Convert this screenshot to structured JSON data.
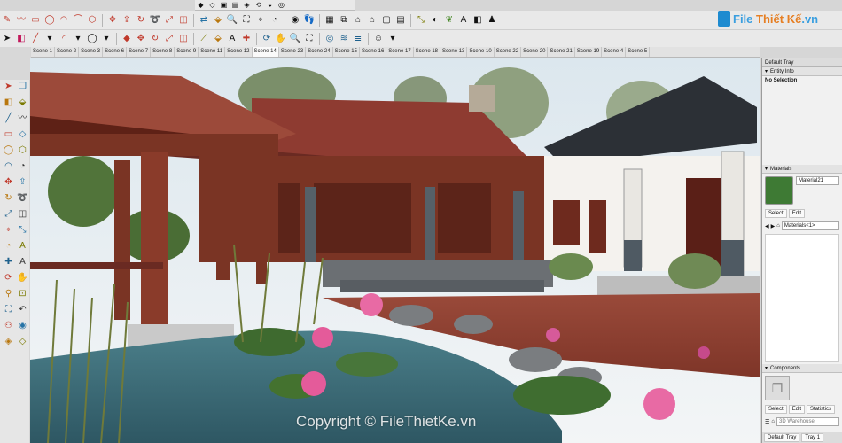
{
  "scenes": [
    "Scene 1",
    "Scene 2",
    "Scene 3",
    "Scene 6",
    "Scene 7",
    "Scene 8",
    "Scene 9",
    "Scene 11",
    "Scene 12",
    "Scene 14",
    "Scene 23",
    "Scene 24",
    "Scene 15",
    "Scene 16",
    "Scene 17",
    "Scene 18",
    "Scene 13",
    "Scene 10",
    "Scene 22",
    "Scene 20",
    "Scene 21",
    "Scene 19",
    "Scene 4",
    "Scene 5"
  ],
  "active_scene": "Scene 14",
  "watermark": {
    "brand": "File",
    "brand2": "Thiết Kế",
    "suffix": ".vn"
  },
  "copyright": "Copyright © FileThietKe.vn",
  "tray": {
    "title": "Default Tray",
    "entity_info": {
      "header": "Entity Info",
      "selection": "No Selection"
    },
    "materials": {
      "header": "Materials",
      "name_value": "Material21",
      "tabs": [
        "Select",
        "Edit"
      ],
      "library_value": "Materials<1>"
    },
    "components": {
      "header": "Components",
      "tabs": [
        "Select",
        "Edit",
        "Statistics"
      ],
      "search_placeholder": "3D Warehouse"
    },
    "bottom_tabs": [
      "Default Tray",
      "Tray 1"
    ]
  },
  "colors": {
    "toolbar_bg": "#e9e9e9",
    "roof_red": "#8e3b31",
    "wood": "#7a3424",
    "water": "#3d6f7c",
    "sky": "#e4ecf1",
    "lotus_pink": "#e45b9a"
  },
  "icons": {
    "top": [
      "pencil-icon",
      "rectangle-icon",
      "circle-icon",
      "arc-icon",
      "polygon-icon",
      "pushpull-icon",
      "move-icon",
      "rotate-icon",
      "scale-icon",
      "offset-icon",
      "tape-icon",
      "text-icon",
      "axes-icon",
      "paint-icon",
      "orbit-icon",
      "pan-icon",
      "zoom-icon",
      "zoom-extents-icon",
      "warehouse-icon",
      "home-icon",
      "section-icon",
      "walk-icon"
    ],
    "left": [
      "select-icon",
      "component-icon",
      "eraser-icon",
      "paint-icon",
      "line-icon",
      "freehand-icon",
      "rectangle-icon",
      "rotated-rectangle-icon",
      "circle-icon",
      "polygon-icon",
      "arc-icon",
      "pie-icon",
      "move-icon",
      "pushpull-icon",
      "rotate-icon",
      "followme-icon",
      "scale-icon",
      "offset-icon",
      "tape-icon",
      "dimension-icon",
      "protractor-icon",
      "text-icon",
      "axes-icon",
      "3dtext-icon",
      "orbit-icon",
      "pan-icon",
      "zoom-icon",
      "zoomwindow-icon",
      "zoom-extents-icon",
      "previous-icon",
      "walk-icon",
      "lookaround-icon",
      "section-icon",
      "display-section-icon"
    ]
  }
}
